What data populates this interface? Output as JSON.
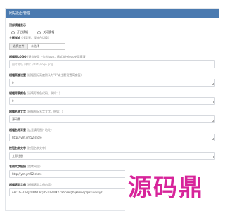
{
  "panel": {
    "title": "网站后台管理"
  },
  "form": {
    "display": {
      "label": "顶部横幅显示",
      "options": [
        "开启横幅",
        "关闭横幅"
      ],
      "selected": 0
    },
    "theme": {
      "label": "主题样式",
      "hint": "(浅背景、深底色切换)",
      "button": "选择文件",
      "value": "未选择"
    },
    "logo": {
      "label": "横幅图LOGO",
      "hint": "(建议使用上传的logo，格式支持logo使用高清)",
      "placeholder": "图片地址 例如：/data/logo.png"
    },
    "height": {
      "label": "横幅高度设置",
      "hint": "(横幅图标高度默认为\"0\"或主题设置高度值)",
      "value": "0"
    },
    "bg": {
      "label": "横幅背景颜色",
      "hint": "(请填写颜色代码，例如：)",
      "value": "0"
    },
    "title1": {
      "label": "横幅名称文字",
      "hint": "(横幅图标名字文字，例如：)",
      "value": "源码鼎"
    },
    "title2": {
      "label": "横幅名称背景",
      "hint": "(这里填写图片地址)",
      "value": "http://ym.ym52.store"
    },
    "btn_text": {
      "label": "按钮右侧文字",
      "hint": "(按钮名字文字)",
      "value": "立即注册"
    },
    "btn_link": {
      "label": "右侧文字链接",
      "hint": "(跳转网址)",
      "value": "http://ym.ym52.store"
    },
    "notice": {
      "label": "横幅滚动字母",
      "hint": "(横幅滚动字母内容)",
      "value": "ABCDEFGHIJKLMNOPQRSTUVWXYZabcdefghijklmnopqrstuvwxyz"
    }
  },
  "watermark": {
    "text": "源码鼎"
  },
  "colors": {
    "header": "#4a7ab0",
    "watermark": "#d7249a"
  }
}
